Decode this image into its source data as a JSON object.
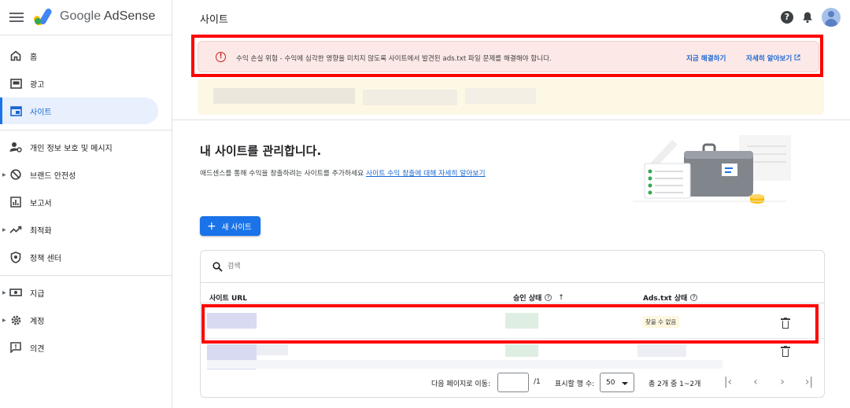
{
  "header": {
    "brand_google": "Google",
    "brand_adsense": "AdSense",
    "page_title": "사이트",
    "help_symbol": "?"
  },
  "sidebar": {
    "items": [
      {
        "label": "홈",
        "icon": "home-icon"
      },
      {
        "label": "광고",
        "icon": "ads-icon"
      },
      {
        "label": "사이트",
        "icon": "sites-icon",
        "active": true
      },
      {
        "label": "개인 정보 보호 및 메시지",
        "icon": "privacy-messaging-icon"
      },
      {
        "label": "브랜드 안전성",
        "icon": "brand-safety-icon"
      },
      {
        "label": "보고서",
        "icon": "reports-icon"
      },
      {
        "label": "최적화",
        "icon": "optimization-icon"
      },
      {
        "label": "정책 센터",
        "icon": "policy-center-icon"
      },
      {
        "label": "지급",
        "icon": "payments-icon"
      },
      {
        "label": "계정",
        "icon": "account-icon"
      },
      {
        "label": "의견",
        "icon": "feedback-icon"
      }
    ]
  },
  "alert": {
    "message": "수익 손실 위험 - 수익에 심각한 영향을 미치지 않도록 사이트에서 발견된 ads.txt 파일 문제를 해결해야 합니다.",
    "fix_now": "지금 해결하기",
    "learn_more": "자세히 알아보기",
    "icon_symbol": "!",
    "color": "#fce8e6"
  },
  "main": {
    "heading": "내 사이트를 관리합니다.",
    "subtext": "애드센스를 통해 수익을 창출하려는 사이트를 추가하세요",
    "subtext_link": "사이트 수익 창출에 대해 자세히 알아보기",
    "new_site_button": "새 사이트",
    "new_site_plus": "+"
  },
  "table": {
    "search_placeholder": "검색",
    "columns": {
      "url": "사이트 URL",
      "approval": "승인 상태",
      "ads_txt": "Ads.txt 상태",
      "sort_arrow": "↑",
      "help_symbol": "?"
    },
    "rows": [
      {
        "ads_txt_status": "찾을 수 없음"
      }
    ]
  },
  "pager": {
    "go_to_page": "다음 페이지로 이동:",
    "page_total": "/1",
    "rows_per_page": "표시할 행 수:",
    "rows_value": "50",
    "range": "총 2개 중 1~2개"
  },
  "colors": {
    "accent": "#1a73e8",
    "highlight_box": "#ff0000"
  }
}
